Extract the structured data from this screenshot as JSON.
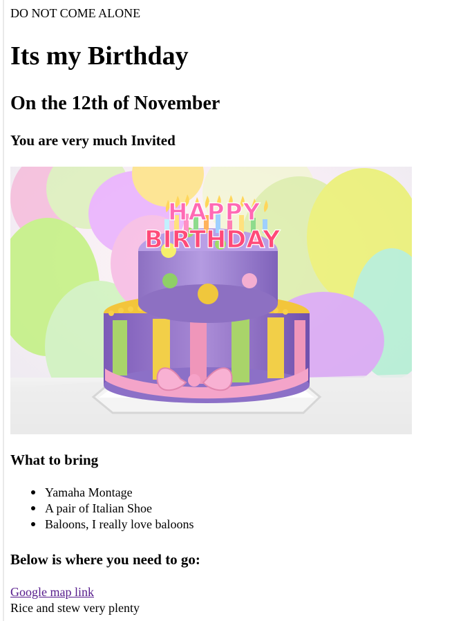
{
  "page": {
    "top_note": "DO NOT COME ALONE",
    "title": "Its my Birthday",
    "date_heading": "On the 12th of November",
    "invite_heading": "You are very much Invited"
  },
  "image": {
    "name": "birthday-cake",
    "text_line_1": "HAPPY",
    "text_line_2": "BIRTHDAY"
  },
  "bring": {
    "title": "What to bring",
    "items": [
      "Yamaha Montage",
      "A pair of Italian Shoe",
      "Baloons, I really love baloons"
    ]
  },
  "location": {
    "title": "Below is where you need to go:",
    "link_text": "Google map link",
    "note": "Rice and stew very plenty"
  },
  "colors": {
    "text": "#000000",
    "visited_link": "#551a8b",
    "page_background": "#ffffff"
  }
}
